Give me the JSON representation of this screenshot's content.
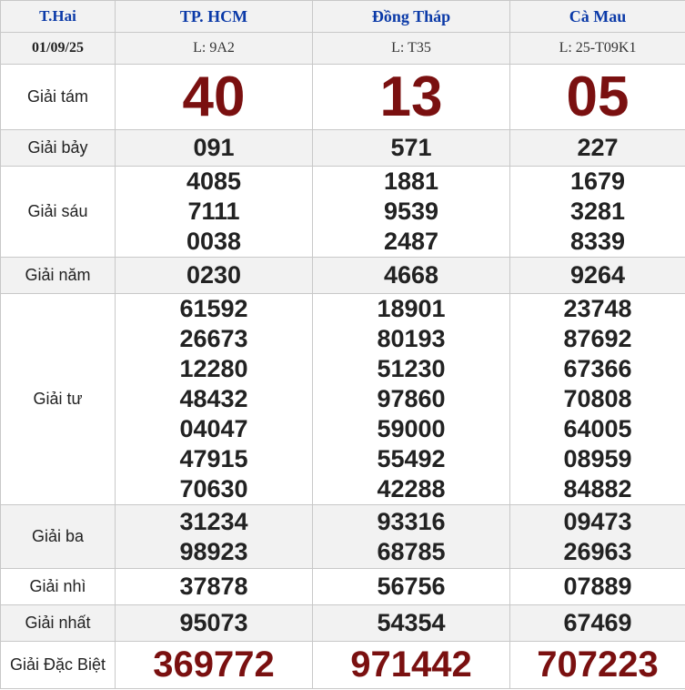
{
  "header": {
    "day": "T.Hai",
    "provinces": [
      "TP. HCM",
      "Đồng Tháp",
      "Cà Mau"
    ]
  },
  "meta": {
    "date": "01/09/25",
    "codes": [
      "L: 9A2",
      "L: T35",
      "L: 25-T09K1"
    ]
  },
  "labels": {
    "g8": "Giải tám",
    "g7": "Giải bảy",
    "g6": "Giải sáu",
    "g5": "Giải năm",
    "g4": "Giải tư",
    "g3": "Giải ba",
    "g2": "Giải nhì",
    "g1": "Giải nhất",
    "db": "Giải Đặc Biệt"
  },
  "results": {
    "g8": [
      "40",
      "13",
      "05"
    ],
    "g7": [
      "091",
      "571",
      "227"
    ],
    "g6": [
      [
        "4085",
        "7111",
        "0038"
      ],
      [
        "1881",
        "9539",
        "2487"
      ],
      [
        "1679",
        "3281",
        "8339"
      ]
    ],
    "g5": [
      "0230",
      "4668",
      "9264"
    ],
    "g4": [
      [
        "61592",
        "26673",
        "12280",
        "48432",
        "04047",
        "47915",
        "70630"
      ],
      [
        "18901",
        "80193",
        "51230",
        "97860",
        "59000",
        "55492",
        "42288"
      ],
      [
        "23748",
        "87692",
        "67366",
        "70808",
        "64005",
        "08959",
        "84882"
      ]
    ],
    "g3": [
      [
        "31234",
        "98923"
      ],
      [
        "93316",
        "68785"
      ],
      [
        "09473",
        "26963"
      ]
    ],
    "g2": [
      "37878",
      "56756",
      "07889"
    ],
    "g1": [
      "95073",
      "54354",
      "67469"
    ],
    "db": [
      "369772",
      "971442",
      "707223"
    ]
  },
  "colors": {
    "header_text": "#0b3aa8",
    "big_number": "#7a1010",
    "shade": "#f2f2f2",
    "border": "#c8c8c8"
  }
}
